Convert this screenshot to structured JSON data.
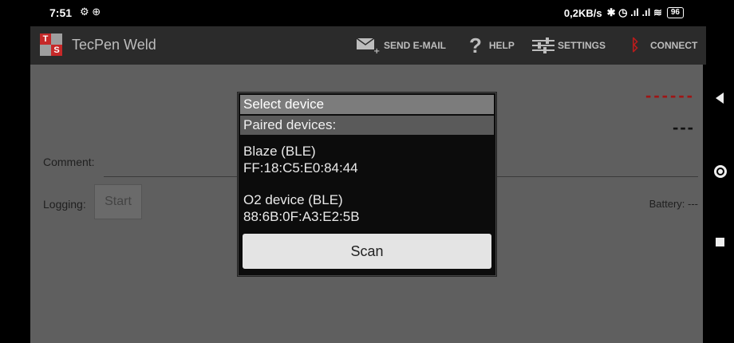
{
  "status_bar": {
    "time": "7:51",
    "left_icons": "⚙ ⊕",
    "net_speed": "0,2KB/s",
    "right_icons": "✱ ◷ .ıl .ıl ≋",
    "battery": "96"
  },
  "app": {
    "title": "TecPen Weld",
    "logo_letters": [
      "T",
      "S"
    ],
    "actions": {
      "send_email": "SEND E-MAIL",
      "help": "HELP",
      "settings": "SETTINGS",
      "connect": "CONNECT"
    }
  },
  "main": {
    "red_dashes": "------",
    "dark_dashes": "---",
    "comment_label": "Comment:",
    "logging_label": "Logging:",
    "start_button": "Start",
    "battery_label": "Battery: ---"
  },
  "dialog": {
    "title": "Select device",
    "section": "Paired devices:",
    "devices": [
      {
        "name": "Blaze (BLE)",
        "address": "FF:18:C5:E0:84:44"
      },
      {
        "name": "O2 device (BLE)",
        "address": "88:6B:0F:A3:E2:5B"
      }
    ],
    "scan_button": "Scan"
  },
  "colors": {
    "accent_red": "#a01515",
    "logo_red": "#c62828",
    "logo_gray": "#9e9e9e"
  }
}
